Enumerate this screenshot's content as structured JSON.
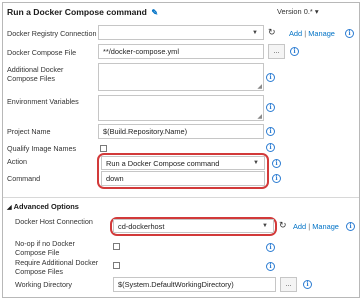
{
  "header": {
    "title": "Run a Docker Compose command",
    "version_label": "Version",
    "version_value": "0.*",
    "version_caret": "▾"
  },
  "fields": {
    "registry_connection": {
      "label": "Docker Registry Connection",
      "value": ""
    },
    "compose_file": {
      "label": "Docker Compose File",
      "value": "**/docker-compose.yml"
    },
    "additional_compose_files": {
      "label": "Additional Docker Compose Files",
      "value": ""
    },
    "environment_variables": {
      "label": "Environment Variables",
      "value": ""
    },
    "project_name": {
      "label": "Project Name",
      "value": "$(Build.Repository.Name)"
    },
    "qualify_image_names": {
      "label": "Qualify Image Names",
      "checked": false
    },
    "action": {
      "label": "Action",
      "value": "Run a Docker Compose command"
    },
    "command": {
      "label": "Command",
      "value": "down"
    }
  },
  "advanced": {
    "title": "Advanced Options",
    "host_connection": {
      "label": "Docker Host Connection",
      "value": "cd-dockerhost"
    },
    "noop": {
      "label": "No-op if no Docker Compose File",
      "checked": false
    },
    "require_additional": {
      "label": "Require Additional Docker Compose Files",
      "checked": false
    },
    "working_directory": {
      "label": "Working Directory",
      "value": "$(System.DefaultWorkingDirectory)"
    }
  },
  "links": {
    "add": "Add",
    "separator": "|",
    "manage": "Manage"
  },
  "buttons": {
    "browse": "..."
  },
  "icons": {
    "info": "i",
    "edit": "pencil-icon",
    "refresh": "refresh-icon",
    "chevron": "chevron-down-icon"
  },
  "colors": {
    "link": "#0072c6",
    "highlight_ring": "#d23a3a",
    "info": "#2d7dd2"
  }
}
